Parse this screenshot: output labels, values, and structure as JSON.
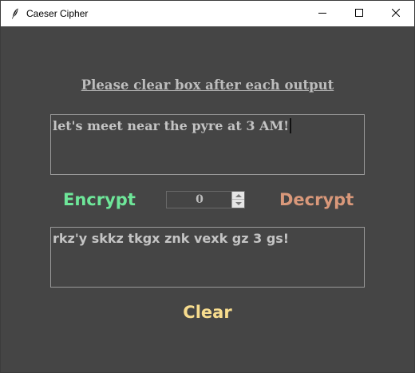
{
  "window": {
    "title": "Caeser Cipher",
    "icon": "feather-icon",
    "controls": [
      "minimize-icon",
      "maximize-icon",
      "close-icon"
    ]
  },
  "main": {
    "instruction": "Please clear box after each output",
    "input_text": "let's meet near the pyre at 3 AM!",
    "output_text": "rkz'y skkz tkgx znk vexk gz 3 gs!",
    "shift_value": "0",
    "encrypt_label": "Encrypt",
    "decrypt_label": "Decrypt",
    "clear_label": "Clear"
  },
  "colors": {
    "background": "#454545",
    "text": "#c4c4c4",
    "encrypt": "#6ee699",
    "decrypt": "#d9987a",
    "clear": "#f7dc8e"
  }
}
